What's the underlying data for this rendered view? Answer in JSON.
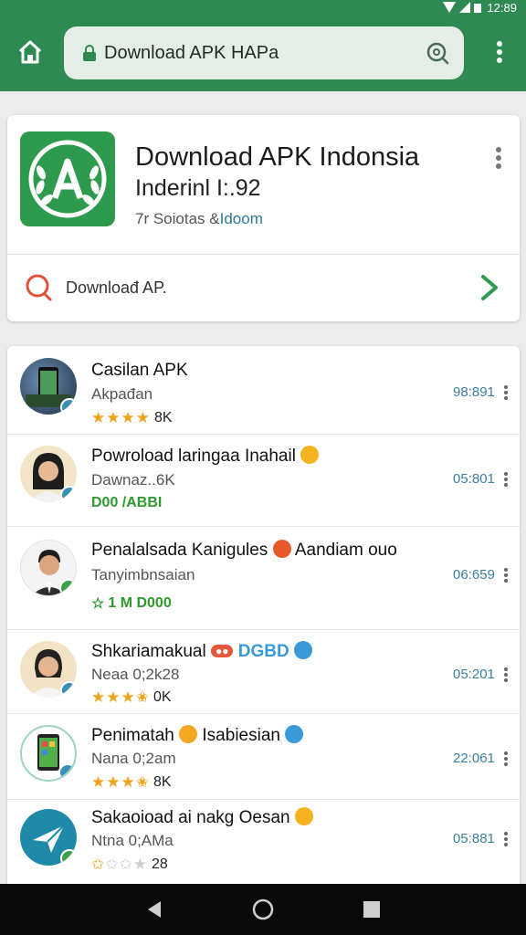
{
  "status": {
    "time": "12:89"
  },
  "toolbar": {
    "url": "Download APK HAPa"
  },
  "app": {
    "title": "Download APK Indonsia",
    "subtitle": "Inderinl I:.92",
    "meta_prefix": "7r Soiotas &",
    "meta_link": "Idoom",
    "search_label": "Downloađ AP."
  },
  "list": [
    {
      "title": "Casilan APK",
      "subtitle": "Akpađan",
      "rating": "4",
      "rating_label": "8K",
      "number": "98:891"
    },
    {
      "title": "Powroload laringaa Inahail",
      "subtitle": "Dawnaz..6K",
      "downloads": "D00 /ABBI",
      "number": "05:801"
    },
    {
      "title": "Penalalsada Kanigules",
      "title_suffix": "Aandiam ouo",
      "subtitle": "Tanyimbnsaian",
      "downloads": "1 M D000",
      "number": "06:659"
    },
    {
      "title": "Shkariamakual",
      "title_suffix": "DGBD",
      "subtitle": "Neaa 0;2k28",
      "rating": "3.5",
      "rating_label": "0K",
      "number": "05:201"
    },
    {
      "title": "Penimatah",
      "title_suffix": "Isabiesian",
      "subtitle": "Nana 0;2am",
      "rating": "3.5",
      "rating_label": "8K",
      "number": "22:061"
    },
    {
      "title": "Sakaoioad ai nakg Oesan",
      "subtitle": "Ntna 0;AMa",
      "rating": "1",
      "rating_label": "28",
      "number": "05:881"
    }
  ],
  "colors": {
    "toolbar": "#2e8a52",
    "accent": "#2e9a4e",
    "link": "#3c7fa0",
    "star": "#f2a31b"
  }
}
